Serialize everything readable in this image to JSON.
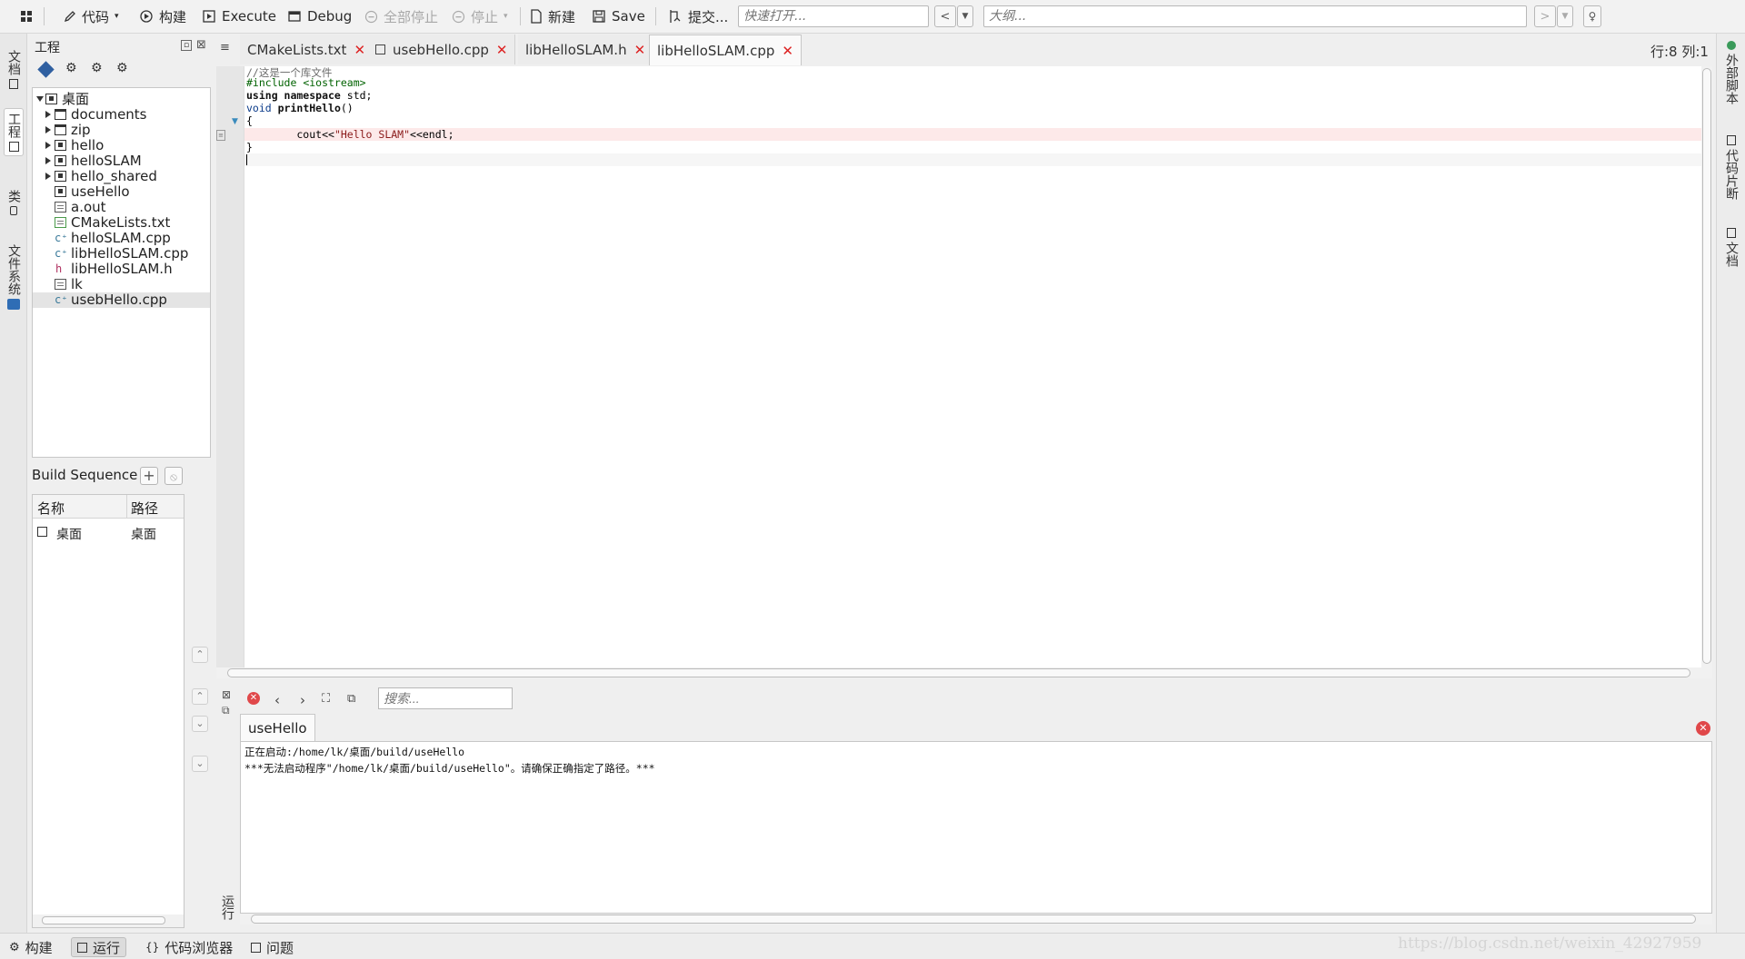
{
  "toolbar": {
    "code": "代码",
    "build": "构建",
    "execute": "Execute",
    "debug": "Debug",
    "stop_all": "全部停止",
    "stop": "停止",
    "new": "新建",
    "save": "Save",
    "commit": "提交...",
    "quick_open_placeholder": "快速打开...",
    "outline_placeholder": "大纲..."
  },
  "left_tabs": [
    "文档",
    "工程",
    "类",
    "文件系统"
  ],
  "project": {
    "title": "工程",
    "root": "桌面",
    "items": [
      {
        "name": "documents",
        "type": "folder"
      },
      {
        "name": "zip",
        "type": "folder"
      },
      {
        "name": "hello",
        "type": "project"
      },
      {
        "name": "helloSLAM",
        "type": "project"
      },
      {
        "name": "hello_shared",
        "type": "project"
      },
      {
        "name": "useHello",
        "type": "project"
      },
      {
        "name": "a.out",
        "type": "file"
      },
      {
        "name": "CMakeLists.txt",
        "type": "cmake"
      },
      {
        "name": "helloSLAM.cpp",
        "type": "cpp"
      },
      {
        "name": "libHelloSLAM.cpp",
        "type": "cpp"
      },
      {
        "name": "libHelloSLAM.h",
        "type": "h"
      },
      {
        "name": "lk",
        "type": "file"
      },
      {
        "name": "usebHello.cpp",
        "type": "cpp",
        "selected": true
      }
    ]
  },
  "build_sequence": {
    "title": "Build Sequence",
    "col_name": "名称",
    "col_path": "路径",
    "row_name": "桌面",
    "row_path": "桌面"
  },
  "editor_tabs": [
    {
      "label": "CMakeLists.txt",
      "active": false
    },
    {
      "label": "usebHello.cpp",
      "active": false
    },
    {
      "label": "libHelloSLAM.h",
      "active": false
    },
    {
      "label": "libHelloSLAM.cpp",
      "active": true
    }
  ],
  "cursor_position": "行:8 列:1",
  "code": {
    "line1": "//这是一个库文件",
    "line2_a": "#include ",
    "line2_b": "<iostream>",
    "line3_kw": "using namespace",
    "line3_rest": " std;",
    "line4_kw": "void",
    "line4_fn": " printHello",
    "line4_rest": "()",
    "line5": "{",
    "line6_a": "        cout<<",
    "line6_str": "\"Hello SLAM\"",
    "line6_b": "<<endl;",
    "line7": "}"
  },
  "output": {
    "search_placeholder": "搜索...",
    "tab_label": "useHello",
    "line1": "正在启动:/home/lk/桌面/build/useHello",
    "line2": "***无法启动程序\"/home/lk/桌面/build/useHello\"。请确保正确指定了路径。***"
  },
  "right_tabs": [
    "外部脚本",
    "代码片断",
    "文档"
  ],
  "run_label": "运行",
  "statusbar": {
    "build": "构建",
    "run": "运行",
    "code_browser": "代码浏览器",
    "problems": "问题"
  },
  "watermark": "https://blog.csdn.net/weixin_42927959",
  "colors": {
    "highlight_line": "#fde9e9",
    "close_red": "#d22222",
    "stop_red": "#e0484a"
  }
}
